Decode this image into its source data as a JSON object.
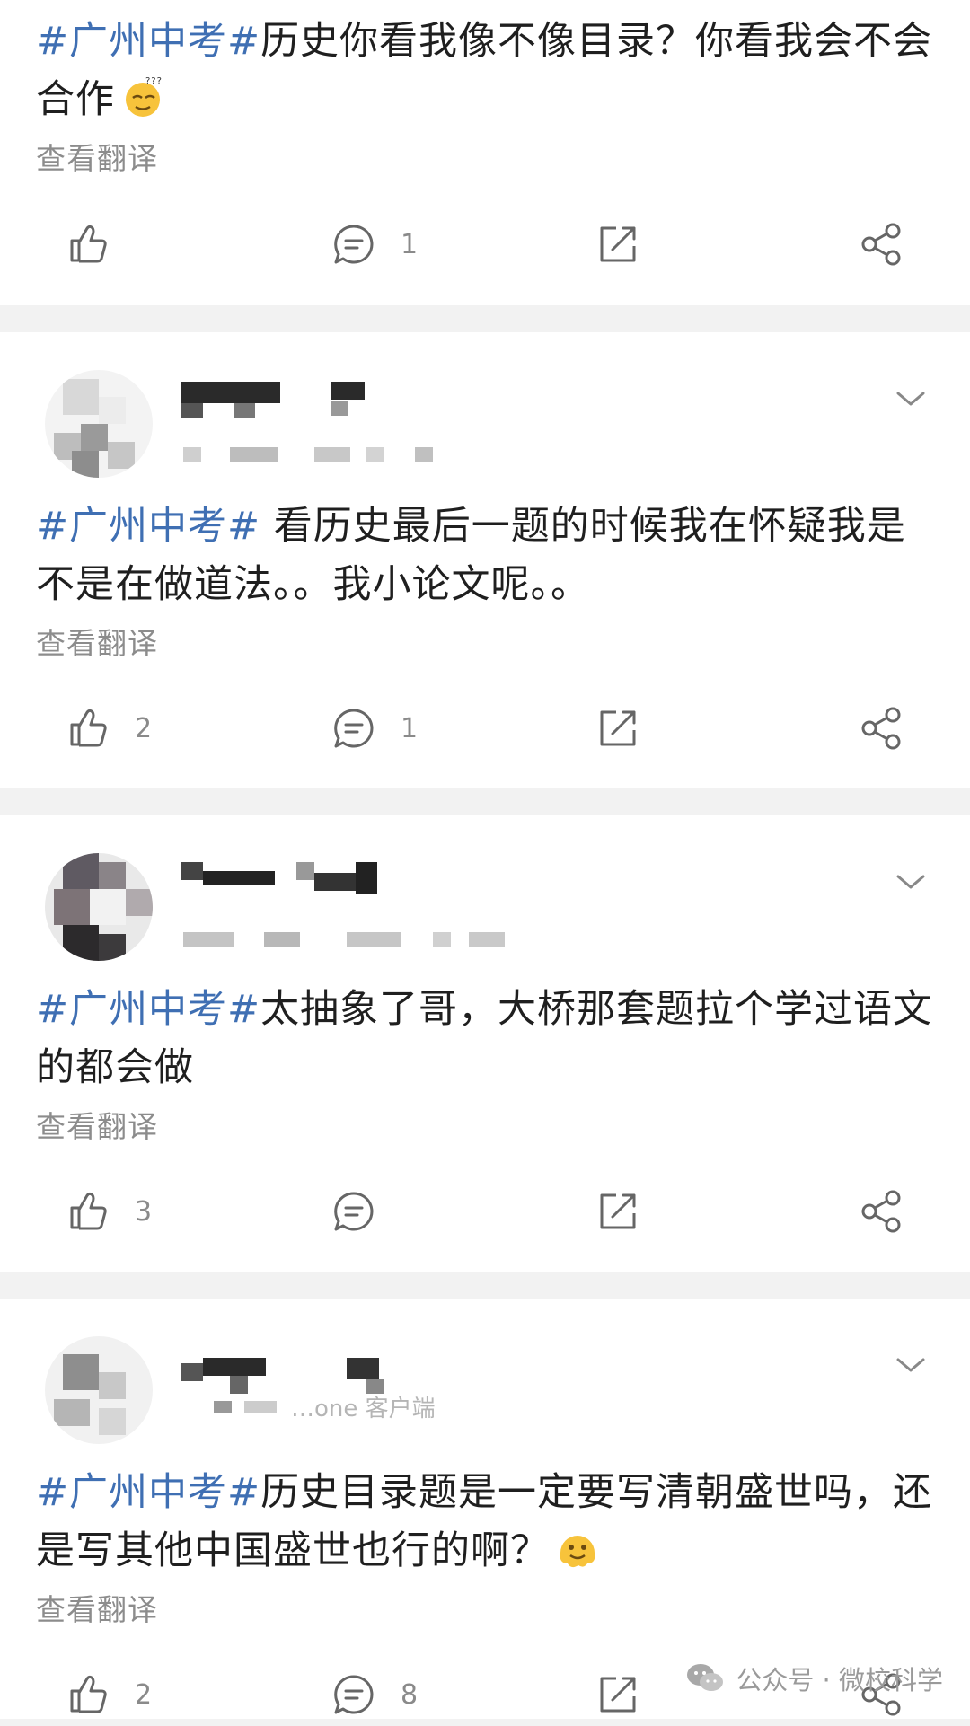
{
  "posts": [
    {
      "tag": "#广州中考#",
      "text": "历史你看我像不像目录？你看我会不会合作",
      "translate": "查看翻译",
      "likes": "",
      "comments": "1"
    },
    {
      "tag": "#广州中考#",
      "text": " 看历史最后一题的时候我在怀疑我是不是在做道法。。我小论文呢。。",
      "translate": "查看翻译",
      "likes": "2",
      "comments": "1"
    },
    {
      "tag": "#广州中考#",
      "text": "太抽象了哥，大桥那套题拉个学过语文的都会做",
      "translate": "查看翻译",
      "likes": "3",
      "comments": ""
    },
    {
      "tag": "#广州中考#",
      "text": "历史目录题是一定要写清朝盛世吗，还是写其他中国盛世也行的啊？",
      "translate": "查看翻译",
      "likes": "2",
      "comments": "8",
      "source_fragment": "…one 客户端"
    }
  ],
  "watermark": {
    "label": "公众号 · 微校科学",
    "icon": "wechat-icon"
  },
  "colors": {
    "hashtag": "#3f6fb3",
    "muted": "#8c8c8c",
    "divider": "#f2f2f2"
  }
}
